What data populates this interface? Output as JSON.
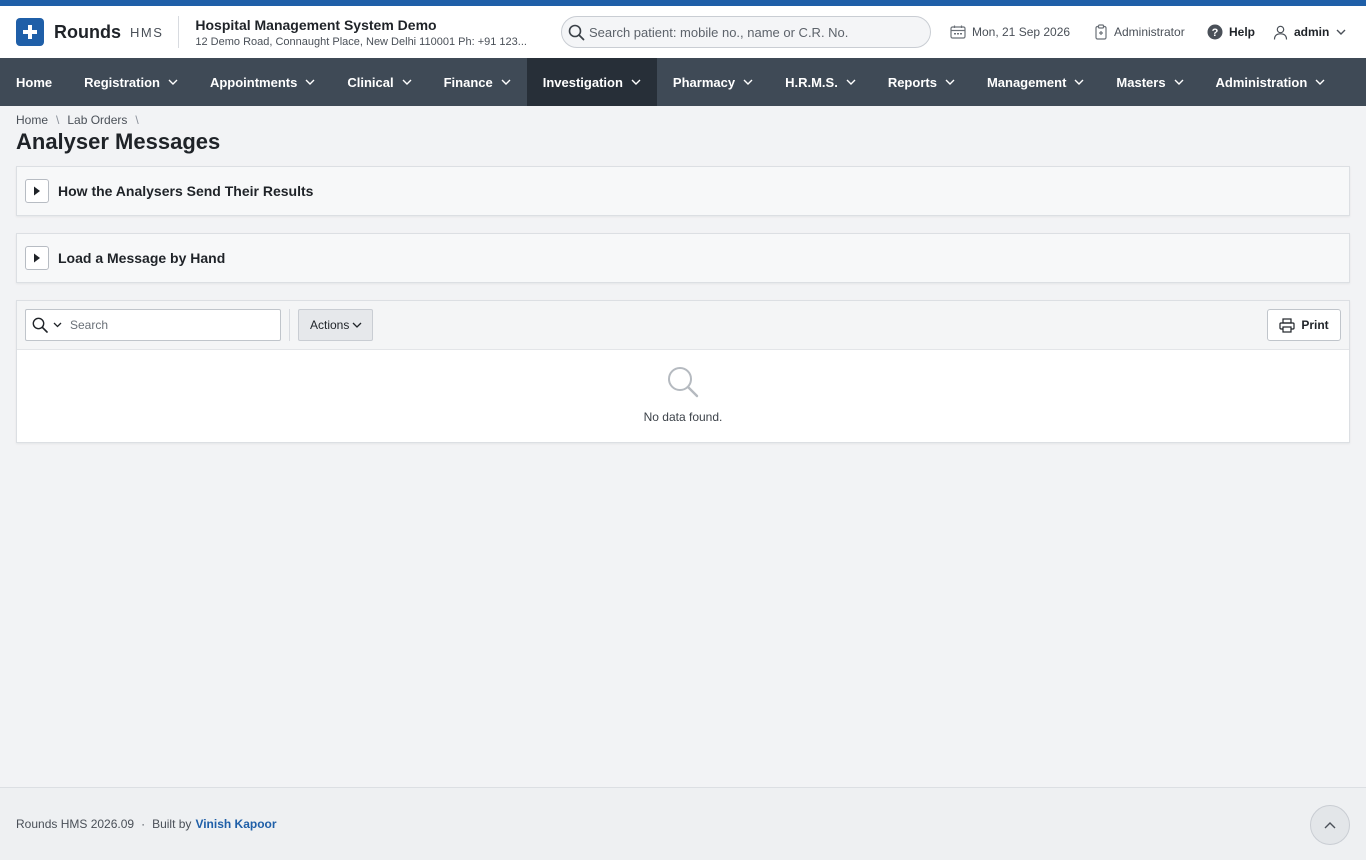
{
  "brand": {
    "name": "Rounds",
    "suffix": "HMS"
  },
  "hospital": {
    "name": "Hospital Management System Demo",
    "address": "12 Demo Road, Connaught Place, New Delhi 110001 Ph: +91 123..."
  },
  "patient_search": {
    "placeholder": "Search patient: mobile no., name or C.R. No."
  },
  "header": {
    "date": "Mon, 21 Sep 2026",
    "role": "Administrator",
    "help": "Help",
    "user": "admin"
  },
  "nav": {
    "items": [
      {
        "label": "Home"
      },
      {
        "label": "Registration"
      },
      {
        "label": "Appointments"
      },
      {
        "label": "Clinical"
      },
      {
        "label": "Finance"
      },
      {
        "label": "Investigation"
      },
      {
        "label": "Pharmacy"
      },
      {
        "label": "H.R.M.S."
      },
      {
        "label": "Reports"
      },
      {
        "label": "Management"
      },
      {
        "label": "Masters"
      },
      {
        "label": "Administration"
      }
    ],
    "active": "Investigation"
  },
  "breadcrumb": {
    "items": [
      "Home",
      "Lab Orders"
    ]
  },
  "page": {
    "title": "Analyser Messages"
  },
  "panels": [
    {
      "title": "How the Analysers Send Their Results"
    },
    {
      "title": "Load a Message by Hand"
    }
  ],
  "report": {
    "search_placeholder": "Search",
    "actions_label": "Actions",
    "print_label": "Print",
    "no_data": "No data found."
  },
  "footer": {
    "version": "Rounds HMS 2026.09",
    "separator": "·",
    "built_by": "Built by",
    "author": "Vinish Kapoor"
  },
  "colors": {
    "brand": "#1f5fa8",
    "nav_bg": "#3f4a56",
    "nav_active": "#272f38",
    "page_bg": "#f2f3f5"
  }
}
